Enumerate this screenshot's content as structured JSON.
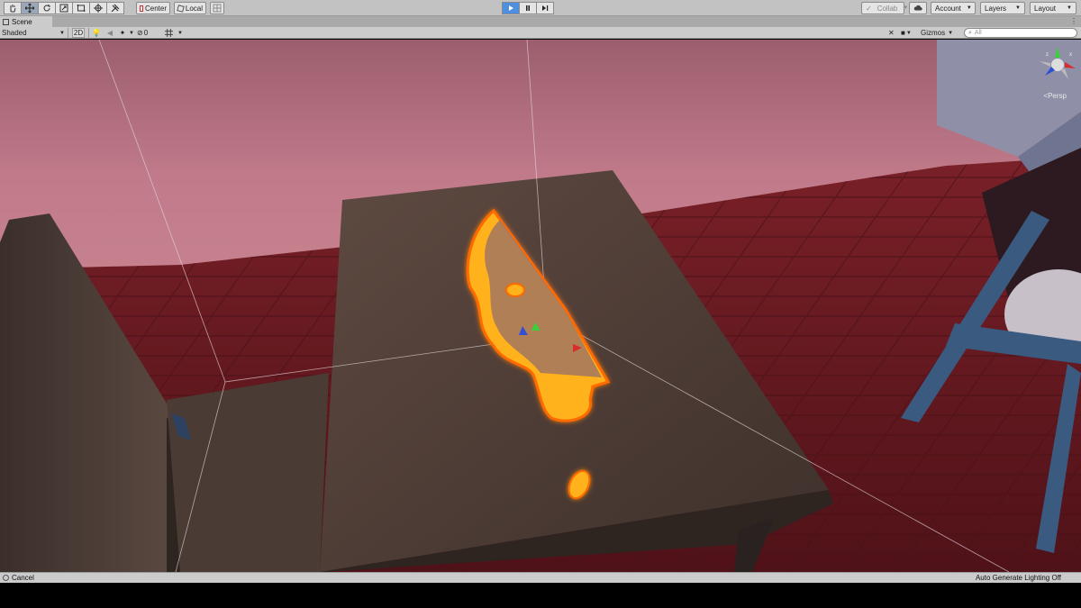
{
  "toolbar": {
    "tools": [
      "hand-tool",
      "move-tool",
      "rotate-tool",
      "scale-tool",
      "rect-tool",
      "transform-tool",
      "custom-tool"
    ],
    "pivot_label": "Center",
    "space_label": "Local",
    "collab_label": "Collab",
    "account_label": "Account",
    "layers_label": "Layers",
    "layout_label": "Layout"
  },
  "scene_tab": {
    "label": "Scene"
  },
  "scene_bar": {
    "shading_mode": "Shaded",
    "mode_2d": "2D",
    "hidden_count": "0",
    "gizmos_label": "Gizmos",
    "search_placeholder": "All"
  },
  "viewport": {
    "projection_label": "Persp"
  },
  "status": {
    "message": "Cancel",
    "lighting": "Auto Generate Lighting Off"
  },
  "colors": {
    "play_active": "#4f8fe0",
    "selection_outline": "#ff8a1c",
    "floor": "#7a1f26",
    "wall": "#b87585"
  }
}
